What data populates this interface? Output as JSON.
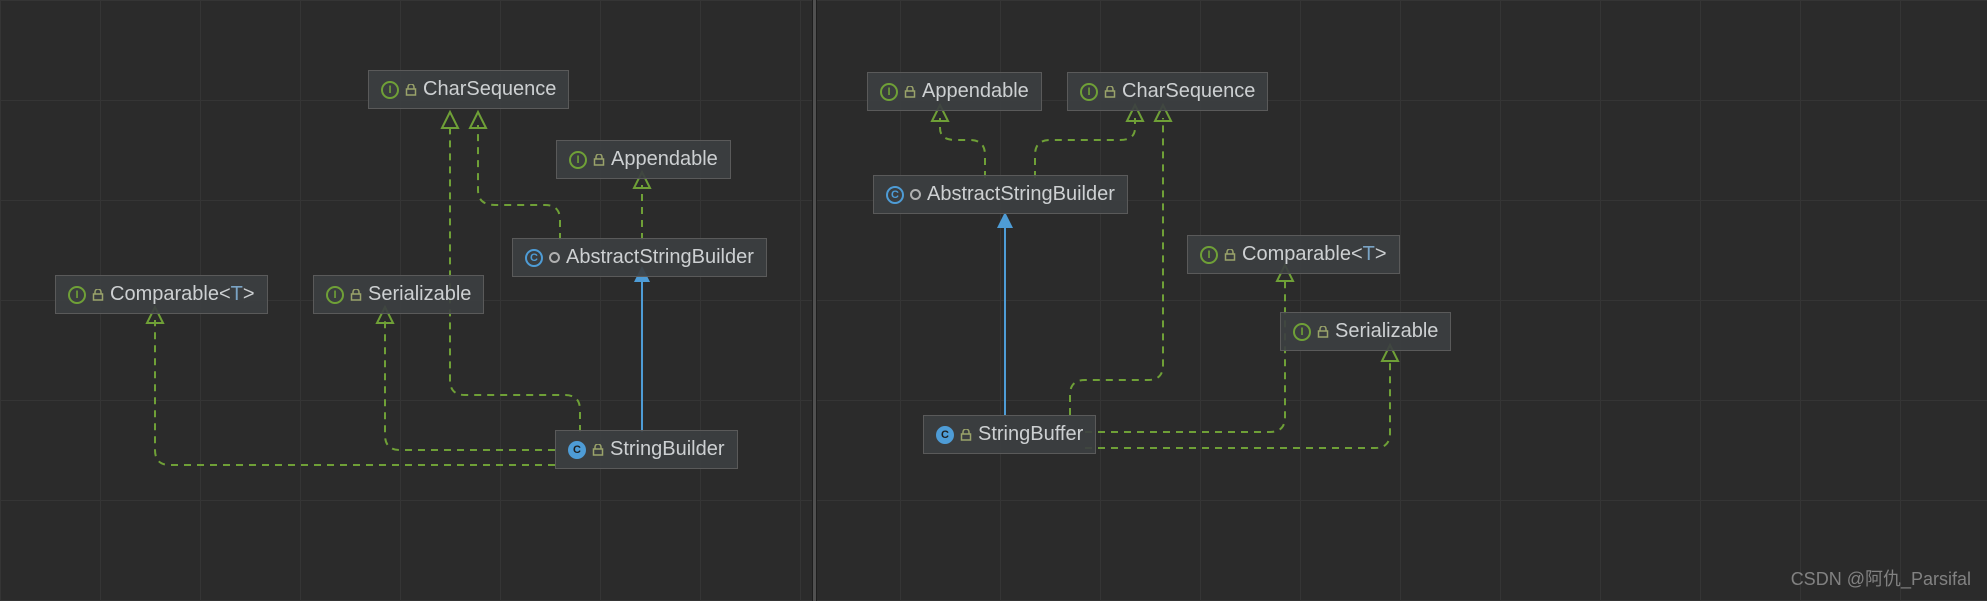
{
  "left": {
    "charSequence": "CharSequence",
    "appendable": "Appendable",
    "abstractStringBuilder": "AbstractStringBuilder",
    "comparable": "Comparable",
    "comparableParam": "T",
    "serializable": "Serializable",
    "stringBuilder": "StringBuilder"
  },
  "right": {
    "appendable": "Appendable",
    "charSequence": "CharSequence",
    "abstractStringBuilder": "AbstractStringBuilder",
    "comparable": "Comparable",
    "comparableParam": "T",
    "serializable": "Serializable",
    "stringBuffer": "StringBuffer"
  },
  "watermark": "CSDN @阿仇_Parsifal",
  "chart_data": [
    {
      "type": "uml-class-diagram",
      "title": "StringBuilder hierarchy",
      "nodes": [
        {
          "id": "CharSequence",
          "kind": "interface"
        },
        {
          "id": "Appendable",
          "kind": "interface"
        },
        {
          "id": "AbstractStringBuilder",
          "kind": "abstract-class"
        },
        {
          "id": "Comparable<T>",
          "kind": "interface"
        },
        {
          "id": "Serializable",
          "kind": "interface"
        },
        {
          "id": "StringBuilder",
          "kind": "class"
        }
      ],
      "edges": [
        {
          "from": "AbstractStringBuilder",
          "to": "CharSequence",
          "rel": "implements"
        },
        {
          "from": "AbstractStringBuilder",
          "to": "Appendable",
          "rel": "implements"
        },
        {
          "from": "StringBuilder",
          "to": "AbstractStringBuilder",
          "rel": "extends"
        },
        {
          "from": "StringBuilder",
          "to": "CharSequence",
          "rel": "implements"
        },
        {
          "from": "StringBuilder",
          "to": "Comparable<T>",
          "rel": "implements"
        },
        {
          "from": "StringBuilder",
          "to": "Serializable",
          "rel": "implements"
        }
      ]
    },
    {
      "type": "uml-class-diagram",
      "title": "StringBuffer hierarchy",
      "nodes": [
        {
          "id": "Appendable",
          "kind": "interface"
        },
        {
          "id": "CharSequence",
          "kind": "interface"
        },
        {
          "id": "AbstractStringBuilder",
          "kind": "abstract-class"
        },
        {
          "id": "Comparable<T>",
          "kind": "interface"
        },
        {
          "id": "Serializable",
          "kind": "interface"
        },
        {
          "id": "StringBuffer",
          "kind": "class"
        }
      ],
      "edges": [
        {
          "from": "AbstractStringBuilder",
          "to": "Appendable",
          "rel": "implements"
        },
        {
          "from": "AbstractStringBuilder",
          "to": "CharSequence",
          "rel": "implements"
        },
        {
          "from": "StringBuffer",
          "to": "AbstractStringBuilder",
          "rel": "extends"
        },
        {
          "from": "StringBuffer",
          "to": "CharSequence",
          "rel": "implements"
        },
        {
          "from": "StringBuffer",
          "to": "Comparable<T>",
          "rel": "implements"
        },
        {
          "from": "StringBuffer",
          "to": "Serializable",
          "rel": "implements"
        }
      ]
    }
  ]
}
